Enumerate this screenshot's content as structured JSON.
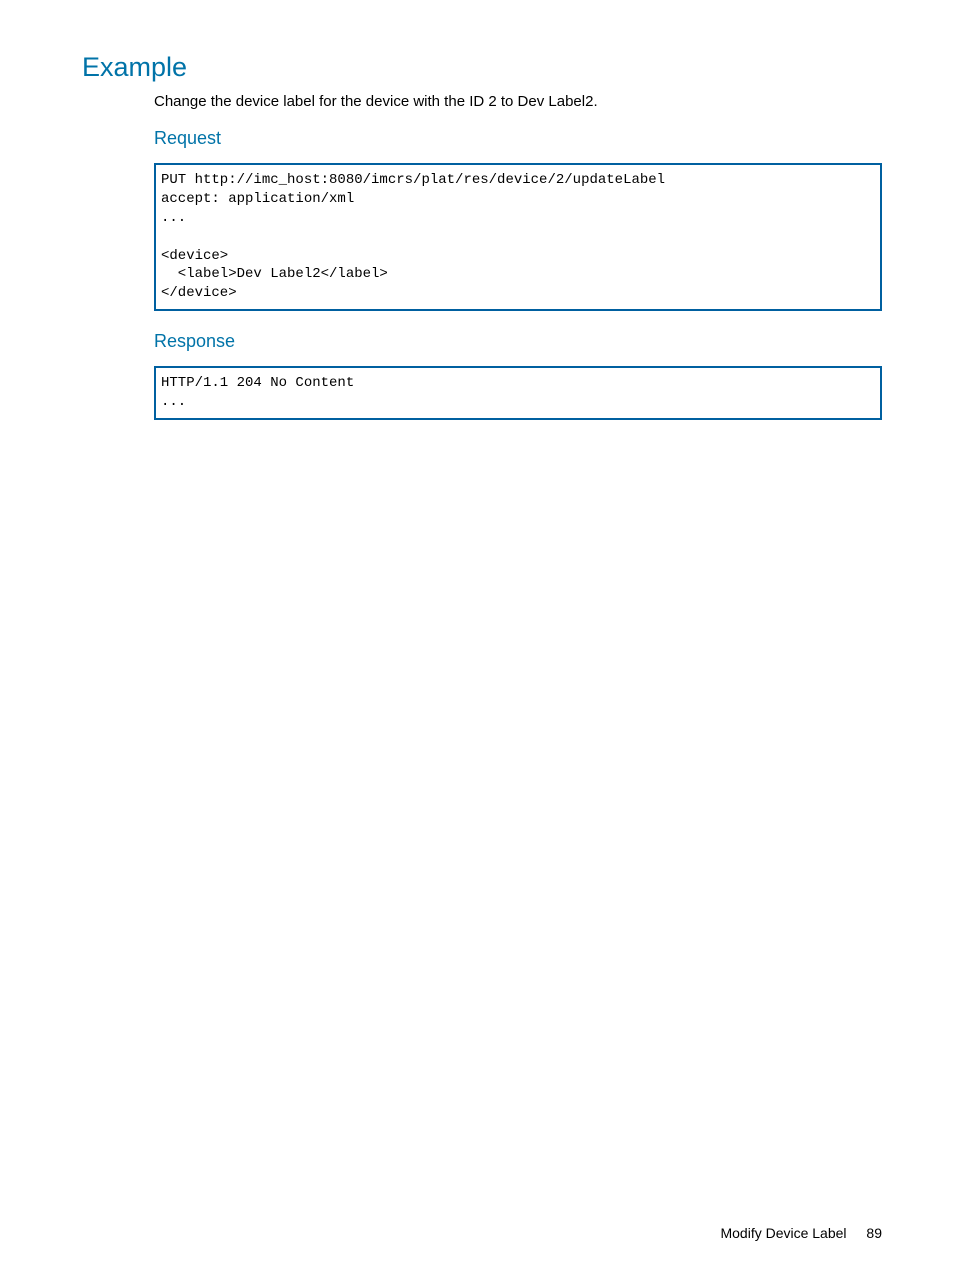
{
  "headings": {
    "example": "Example",
    "request": "Request",
    "response": "Response"
  },
  "description": "Change the device label for the device with the ID 2 to Dev Label2.",
  "code": {
    "request": "PUT http://imc_host:8080/imcrs/plat/res/device/2/updateLabel\naccept: application/xml\n...\n\n<device>\n  <label>Dev Label2</label>\n</device>",
    "response": "HTTP/1.1 204 No Content\n..."
  },
  "footer": {
    "title": "Modify Device Label",
    "page": "89"
  }
}
